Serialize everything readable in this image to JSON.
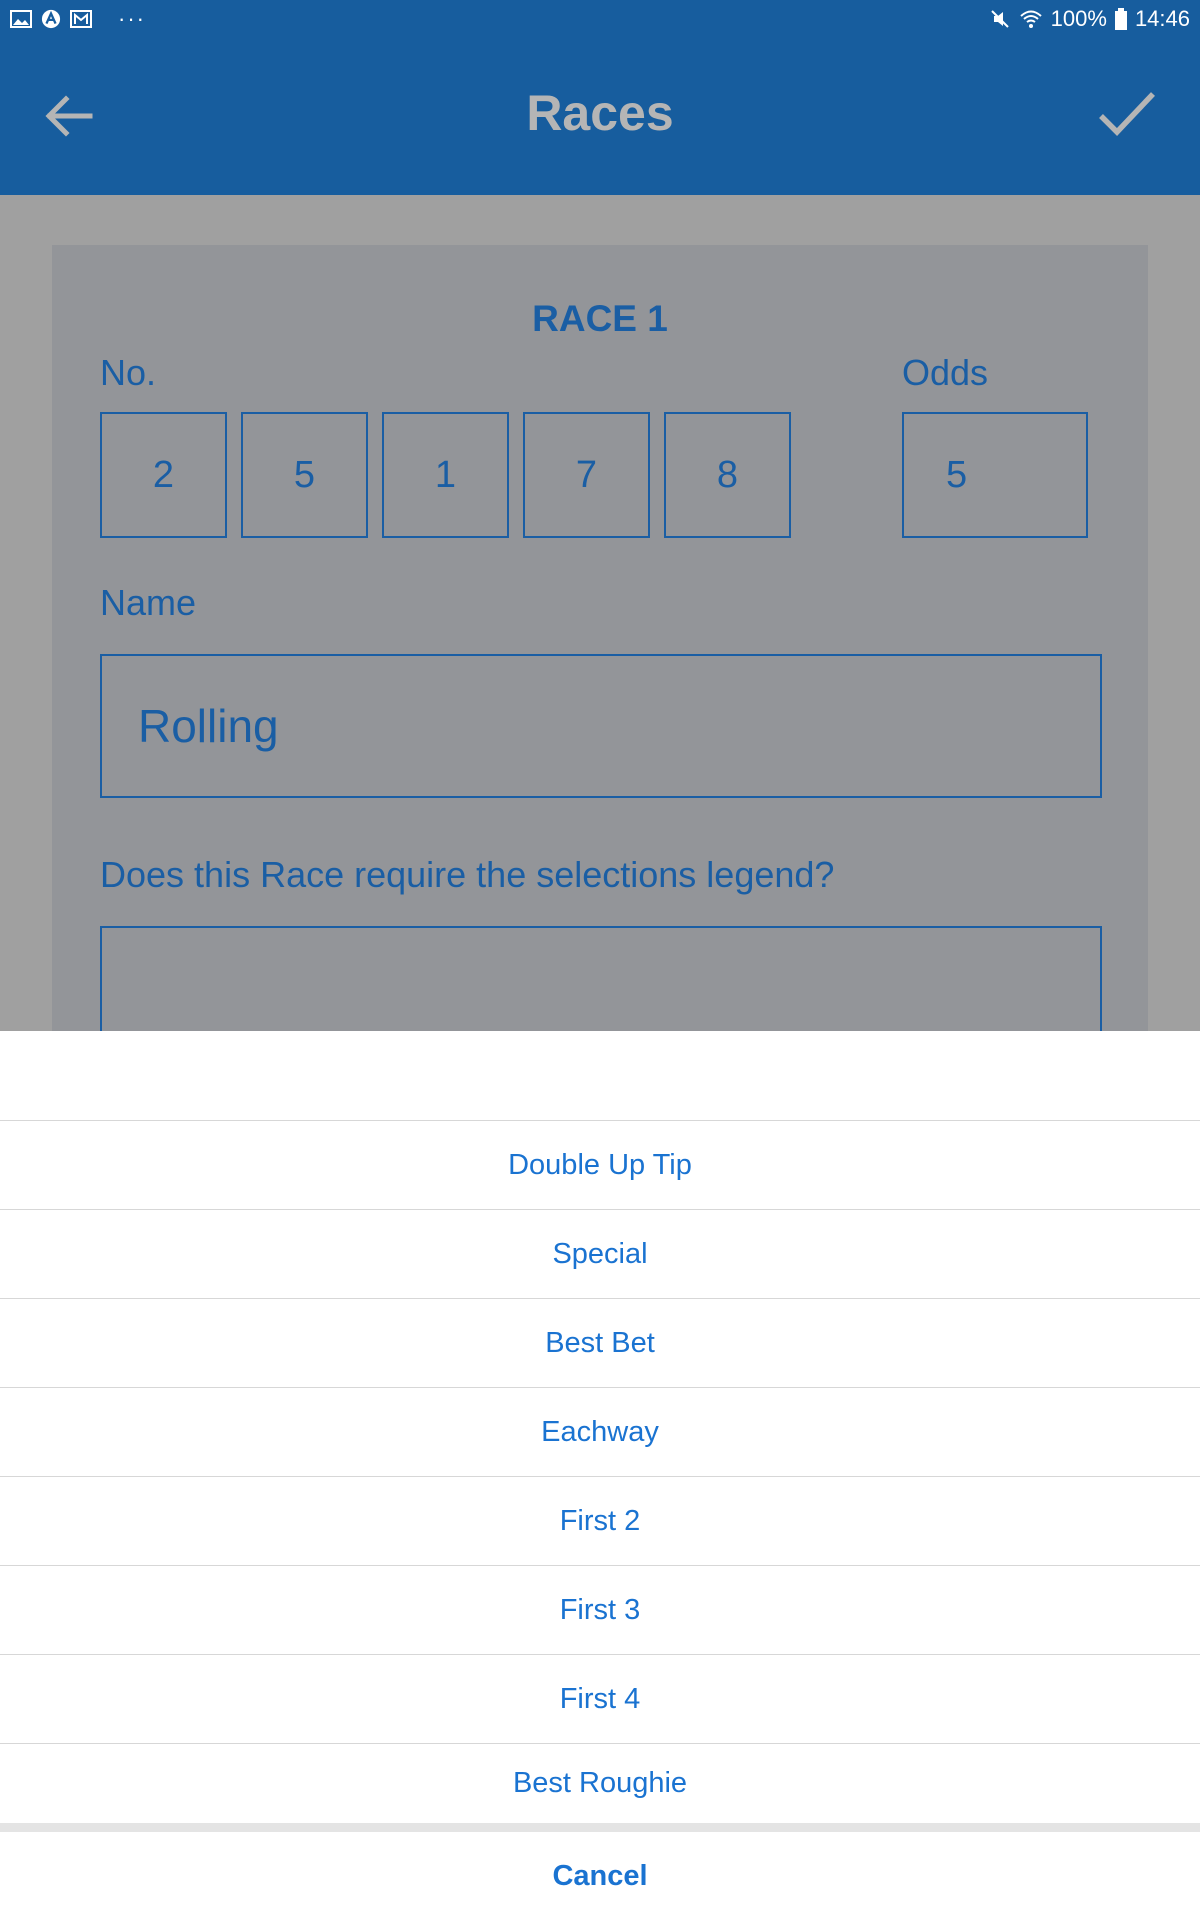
{
  "status_bar": {
    "battery": "100%",
    "time": "14:46",
    "more": "···"
  },
  "app_bar": {
    "title": "Races"
  },
  "form": {
    "race_title": "RACE 1",
    "no_label": "No.",
    "odds_label": "Odds",
    "numbers": [
      "2",
      "5",
      "1",
      "7",
      "8"
    ],
    "odds": "5",
    "name_label": "Name",
    "name_value": "Rolling",
    "legend_question": "Does this Race require the selections legend?"
  },
  "action_sheet": {
    "options": [
      "Double Up Tip",
      "Special",
      "Best Bet",
      "Eachway",
      "First 2",
      "First 3",
      "First 4",
      "Best Roughie"
    ],
    "cancel_label": "Cancel"
  },
  "colors": {
    "app_bar": "#175d9e",
    "form_text": "#1a5ea4",
    "sheet_text": "#1a73d1"
  }
}
